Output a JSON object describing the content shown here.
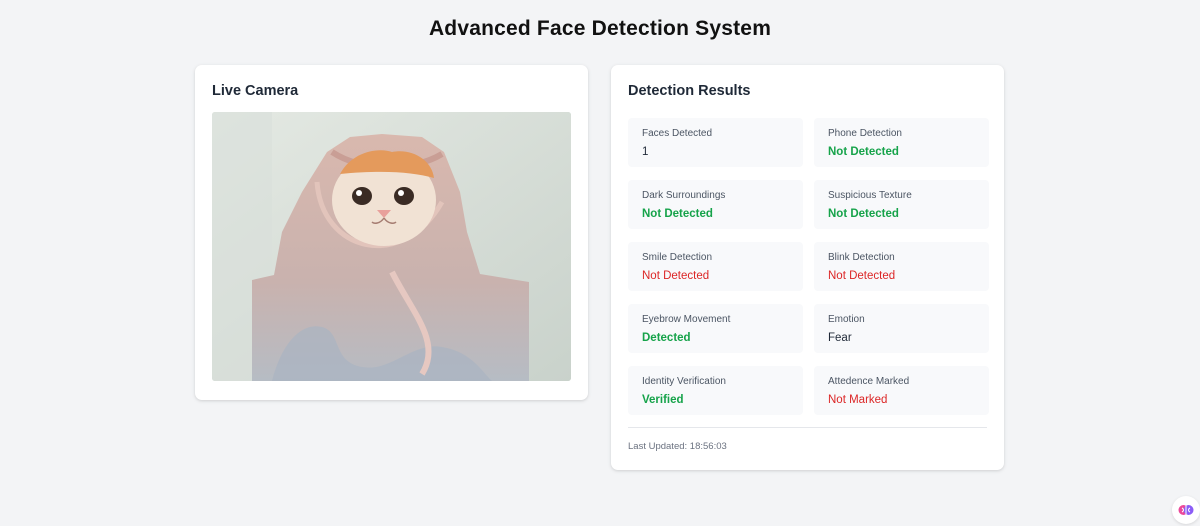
{
  "page": {
    "title": "Advanced Face Detection System"
  },
  "camera": {
    "title": "Live Camera",
    "icon": "camera-feed"
  },
  "results": {
    "title": "Detection Results",
    "items": [
      {
        "label": "Faces Detected",
        "value": "1",
        "status": "neutral"
      },
      {
        "label": "Phone Detection",
        "value": "Not Detected",
        "status": "ok"
      },
      {
        "label": "Dark Surroundings",
        "value": "Not Detected",
        "status": "ok"
      },
      {
        "label": "Suspicious Texture",
        "value": "Not Detected",
        "status": "ok"
      },
      {
        "label": "Smile Detection",
        "value": "Not Detected",
        "status": "bad"
      },
      {
        "label": "Blink Detection",
        "value": "Not Detected",
        "status": "bad"
      },
      {
        "label": "Eyebrow Movement",
        "value": "Detected",
        "status": "ok"
      },
      {
        "label": "Emotion",
        "value": "Fear",
        "status": "neutral"
      },
      {
        "label": "Identity Verification",
        "value": "Verified",
        "status": "ok"
      },
      {
        "label": "Attedence Marked",
        "value": "Not Marked",
        "status": "bad"
      }
    ],
    "last_updated": "Last Updated: 18:56:03"
  },
  "colors": {
    "ok": "#16a34a",
    "bad": "#dc2626",
    "background": "#f3f4f6"
  },
  "badge": {
    "icon": "brain-icon"
  }
}
